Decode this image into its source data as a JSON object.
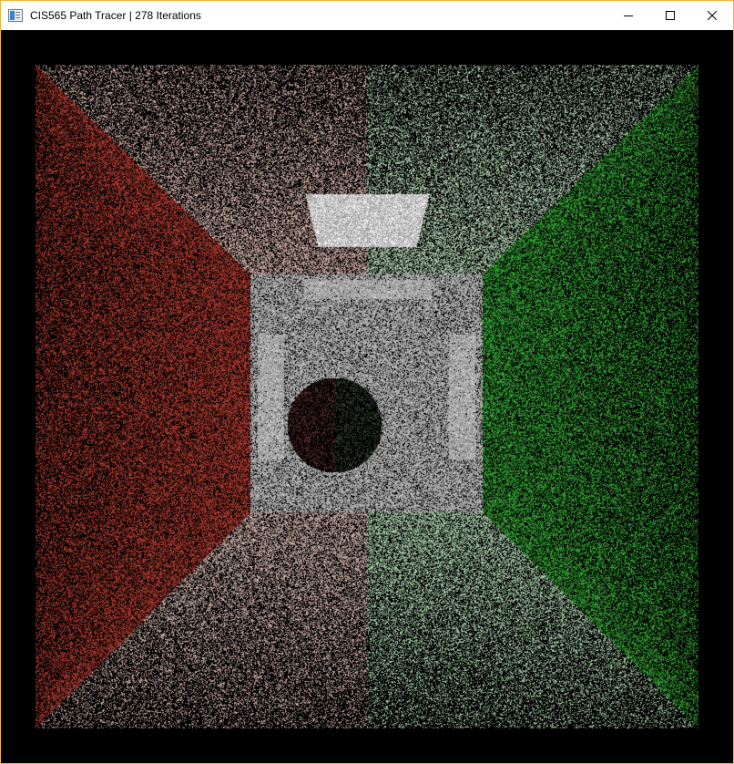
{
  "window": {
    "title": "CIS565 Path Tracer | 278 Iterations",
    "controls": {
      "minimize": "minimize",
      "maximize": "maximize",
      "close": "close"
    }
  },
  "render": {
    "scene": "cornell-box",
    "iterations": 278,
    "colors": {
      "left_wall": "#c84438",
      "right_wall": "#3fbe3f",
      "back_wall": "#d8d8d8",
      "floor": "#cfcfcf",
      "ceiling": "#cfcfcf",
      "light": "#ffffff",
      "sphere": "#3a3a3a"
    }
  }
}
